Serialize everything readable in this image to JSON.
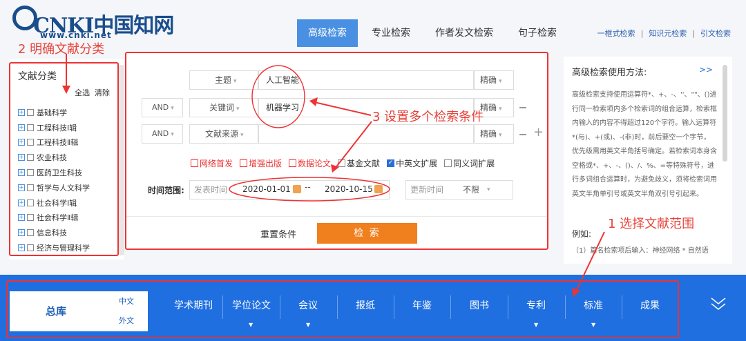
{
  "header": {
    "logo_text": "CNKI中国知网",
    "logo_url": "www.cnki.net",
    "tabs": [
      "高级检索",
      "专业检索",
      "作者发文检索",
      "句子检索"
    ],
    "active_tab": "高级检索",
    "links": [
      "一框式检索",
      "知识元检索",
      "引文检索"
    ]
  },
  "annotations": {
    "step1": "1 选择文献范围",
    "step2": "2 明确文献分类",
    "step3": "3 设置多个检索条件"
  },
  "sidebar": {
    "title": "文献分类",
    "select_all": "全选",
    "clear": "清除",
    "items": [
      "基础科学",
      "工程科技Ⅰ辑",
      "工程科技Ⅱ辑",
      "农业科技",
      "医药卫生科技",
      "哲学与人文科学",
      "社会科学Ⅰ辑",
      "社会科学Ⅱ辑",
      "信息科技",
      "经济与管理科学"
    ]
  },
  "form": {
    "rows": [
      {
        "logic": "",
        "field": "主题",
        "value": "人工智能",
        "match": "精确"
      },
      {
        "logic": "AND",
        "field": "关键词",
        "value": "机器学习",
        "match": "精确"
      },
      {
        "logic": "AND",
        "field": "文献来源",
        "value": "",
        "match": "精确"
      }
    ],
    "options": [
      {
        "label": "网络首发",
        "checked": false,
        "red": true
      },
      {
        "label": "增强出版",
        "checked": false,
        "red": true
      },
      {
        "label": "数据论文",
        "checked": false,
        "red": true
      },
      {
        "label": "基金文献",
        "checked": false,
        "red": false
      },
      {
        "label": "中英文扩展",
        "checked": true,
        "red": false
      },
      {
        "label": "同义词扩展",
        "checked": false,
        "red": false
      }
    ],
    "time_label": "时间范围:",
    "publish_time_placeholder": "发表时间",
    "date_from": "2020-01-01",
    "date_sep": "--",
    "date_to": "2020-10-15",
    "update_time_label": "更新时间",
    "update_time_value": "不限",
    "reset_label": "重置条件",
    "search_label": "检 索"
  },
  "help": {
    "title": "高级检索使用方法:",
    "more": ">>",
    "body": "高级检索支持使用运算符*、+、-、''、\"\"、()进行同一检索项内多个检索词的组合运算，检索框内输入的内容不得超过120个字符。输入运算符*(与)、+(或)、-(非)时，前后要空一个字节，优先级需用英文半角括号确定。若检索词本身含空格或*、+、-、()、/、%、=等特殊符号，进行多词组合运算时，为避免歧义，须将检索词用英文半角单引号或英文半角双引号引起来。",
    "example_title": "例如:",
    "example_line": "（1）篇名检索项后输入：神经网络 * 自然语"
  },
  "db_bar": {
    "main": "总库",
    "lang_zh": "中文",
    "lang_en": "外文",
    "items": [
      "学术期刊",
      "学位论文",
      "会议",
      "报纸",
      "年鉴",
      "图书",
      "专利",
      "标准",
      "成果"
    ]
  }
}
